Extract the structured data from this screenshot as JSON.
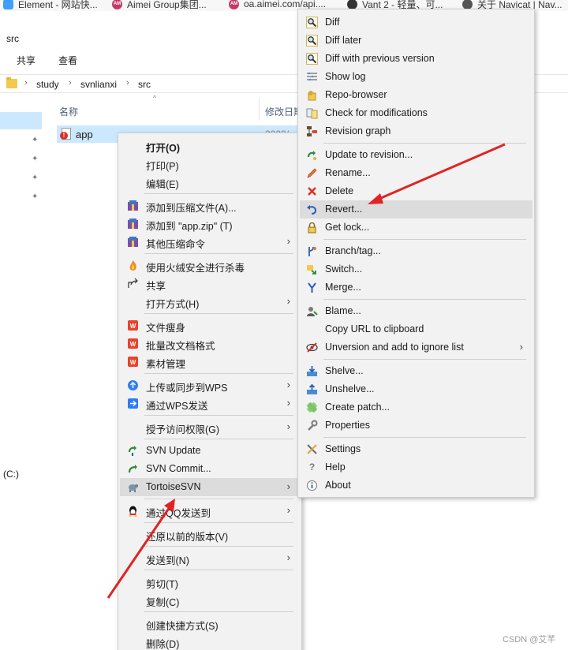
{
  "bookmarks": [
    {
      "label": "Element - 网站快...",
      "icon": "element-icon"
    },
    {
      "label": "Aimei Group集团...",
      "icon": "am-icon"
    },
    {
      "label": "oa.aimei.com/api....",
      "icon": "am-icon"
    },
    {
      "label": "Vant 2 - 轻量、可...",
      "icon": "vant-icon"
    },
    {
      "label": "关于 Navicat | Nav...",
      "icon": "github-icon"
    }
  ],
  "window": {
    "title": "src"
  },
  "ribbon": {
    "share": "共享",
    "view": "查看"
  },
  "address": {
    "crumbs": [
      "study",
      "svnlianxi",
      "src"
    ]
  },
  "columns": {
    "name": "名称",
    "modified": "修改日期"
  },
  "file": {
    "name": "app",
    "date": "2023/"
  },
  "nav": {
    "drive": "(C:)"
  },
  "context_menu": {
    "items": [
      {
        "label": "打开(O)",
        "bold": true
      },
      {
        "label": "打印(P)"
      },
      {
        "label": "编辑(E)"
      },
      {
        "label": "添加到压缩文件(A)..."
      },
      {
        "label": "添加到 \"app.zip\" (T)"
      },
      {
        "label": "其他压缩命令"
      },
      {
        "label": "使用火绒安全进行杀毒"
      },
      {
        "label": "共享"
      },
      {
        "label": "打开方式(H)"
      },
      {
        "label": "文件瘦身"
      },
      {
        "label": "批量改文档格式"
      },
      {
        "label": "素材管理"
      },
      {
        "label": "上传或同步到WPS"
      },
      {
        "label": "通过WPS发送"
      },
      {
        "label": "授予访问权限(G)"
      },
      {
        "label": "SVN Update"
      },
      {
        "label": "SVN Commit..."
      },
      {
        "label": "TortoiseSVN"
      },
      {
        "label": "通过QQ发送到"
      },
      {
        "label": "还原以前的版本(V)"
      },
      {
        "label": "发送到(N)"
      },
      {
        "label": "剪切(T)"
      },
      {
        "label": "复制(C)"
      },
      {
        "label": "创建快捷方式(S)"
      },
      {
        "label": "删除(D)"
      }
    ]
  },
  "svn_menu": {
    "items": [
      {
        "label": "Diff"
      },
      {
        "label": "Diff later"
      },
      {
        "label": "Diff with previous version"
      },
      {
        "label": "Show log"
      },
      {
        "label": "Repo-browser"
      },
      {
        "label": "Check for modifications"
      },
      {
        "label": "Revision graph"
      },
      {
        "label": "Update to revision..."
      },
      {
        "label": "Rename..."
      },
      {
        "label": "Delete"
      },
      {
        "label": "Revert..."
      },
      {
        "label": "Get lock..."
      },
      {
        "label": "Branch/tag..."
      },
      {
        "label": "Switch..."
      },
      {
        "label": "Merge..."
      },
      {
        "label": "Blame..."
      },
      {
        "label": "Copy URL to clipboard"
      },
      {
        "label": "Unversion and add to ignore list"
      },
      {
        "label": "Shelve..."
      },
      {
        "label": "Unshelve..."
      },
      {
        "label": "Create patch..."
      },
      {
        "label": "Properties"
      },
      {
        "label": "Settings"
      },
      {
        "label": "Help"
      },
      {
        "label": "About"
      }
    ]
  },
  "watermark": "CSDN @艾芊",
  "colors": {
    "selection": "#cce8ff",
    "menu_bg": "#f2f2f2",
    "hover": "#dcdcdc",
    "arrow": "#e02424"
  }
}
